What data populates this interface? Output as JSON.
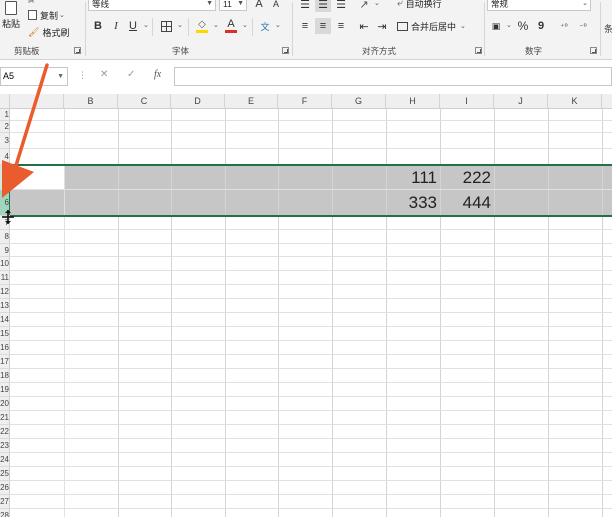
{
  "ribbon": {
    "clipboard": {
      "paste_label": "粘贴",
      "copy_label": "复制",
      "format_painter_label": "格式刷",
      "group_label": "剪贴板"
    },
    "font": {
      "font_name": "等线",
      "font_size": "11",
      "grow_label": "A",
      "shrink_label": "A",
      "bold": "B",
      "italic": "I",
      "underline": "U",
      "phonetic": "文",
      "font_color_letter": "A",
      "group_label": "字体"
    },
    "alignment": {
      "wrap_text_label": "自动换行",
      "merge_center_label": "合并后居中",
      "group_label": "对齐方式"
    },
    "number": {
      "format_value": "常规",
      "percent": "%",
      "comma": "9",
      "group_label": "数字"
    },
    "colors": {
      "fill_accent": "#ffd700",
      "font_accent": "#d9302c",
      "excel_green": "#217346",
      "arrow": "#ea5b2d"
    }
  },
  "formula_bar": {
    "name_box_value": "A5",
    "cancel": "✕",
    "enter": "✓",
    "fx": "fx",
    "formula_value": ""
  },
  "grid": {
    "columns": [
      "B",
      "C",
      "D",
      "E",
      "F",
      "G",
      "H",
      "I",
      "J",
      "K"
    ],
    "column_a_partial": "",
    "rows": [
      "1",
      "2",
      "3",
      "4",
      "5",
      "6",
      "7",
      "8",
      "9",
      "10",
      "11",
      "12",
      "13",
      "14",
      "15",
      "16",
      "17",
      "18",
      "19",
      "20",
      "21",
      "22",
      "23",
      "24",
      "25",
      "26",
      "27",
      "28"
    ],
    "cells": {
      "H4": "111",
      "I4": "222",
      "H5": "333",
      "I5": "444"
    }
  }
}
